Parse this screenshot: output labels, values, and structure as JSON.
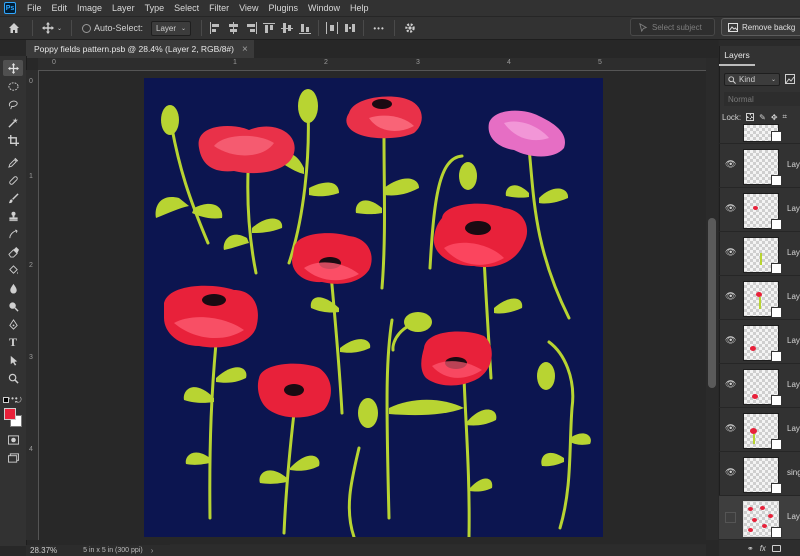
{
  "app": {
    "logo_text": "Ps"
  },
  "menu": [
    "File",
    "Edit",
    "Image",
    "Layer",
    "Type",
    "Select",
    "Filter",
    "View",
    "Plugins",
    "Window",
    "Help"
  ],
  "options": {
    "auto_select_label": "Auto-Select:",
    "auto_select_target": "Layer",
    "more_label": "•••",
    "select_subject": "Select subject",
    "remove_background": "Remove backg"
  },
  "document": {
    "tab_title": "Poppy fields pattern.psb @ 28.4% (Layer 2, RGB/8#)",
    "close_glyph": "×"
  },
  "rulers": {
    "top": [
      "0",
      "1",
      "2",
      "3",
      "4",
      "5"
    ],
    "left": [
      "0",
      "1",
      "2",
      "3",
      "4"
    ]
  },
  "status": {
    "zoom": "28.37%",
    "doc_size": "5 in x 5 in (300 ppi)"
  },
  "colors": {
    "foreground": "#e8213a",
    "background": "#ffffff",
    "canvas": "#0c1550",
    "accent": "#31a8ff"
  },
  "layers_panel": {
    "tab_label": "Layers",
    "filter_kind": "Kind",
    "blend_mode": "Normal",
    "lock_label": "Lock:",
    "layers": [
      {
        "name": "Laye",
        "visible": true
      },
      {
        "name": "Laye",
        "visible": true
      },
      {
        "name": "Laye",
        "visible": true
      },
      {
        "name": "Laye",
        "visible": true
      },
      {
        "name": "Laye",
        "visible": true
      },
      {
        "name": "Laye",
        "visible": true
      },
      {
        "name": "Laye",
        "visible": true
      },
      {
        "name": "sing",
        "visible": true
      },
      {
        "name": "Laye",
        "visible": false
      }
    ],
    "bottom_fx": "fx"
  }
}
